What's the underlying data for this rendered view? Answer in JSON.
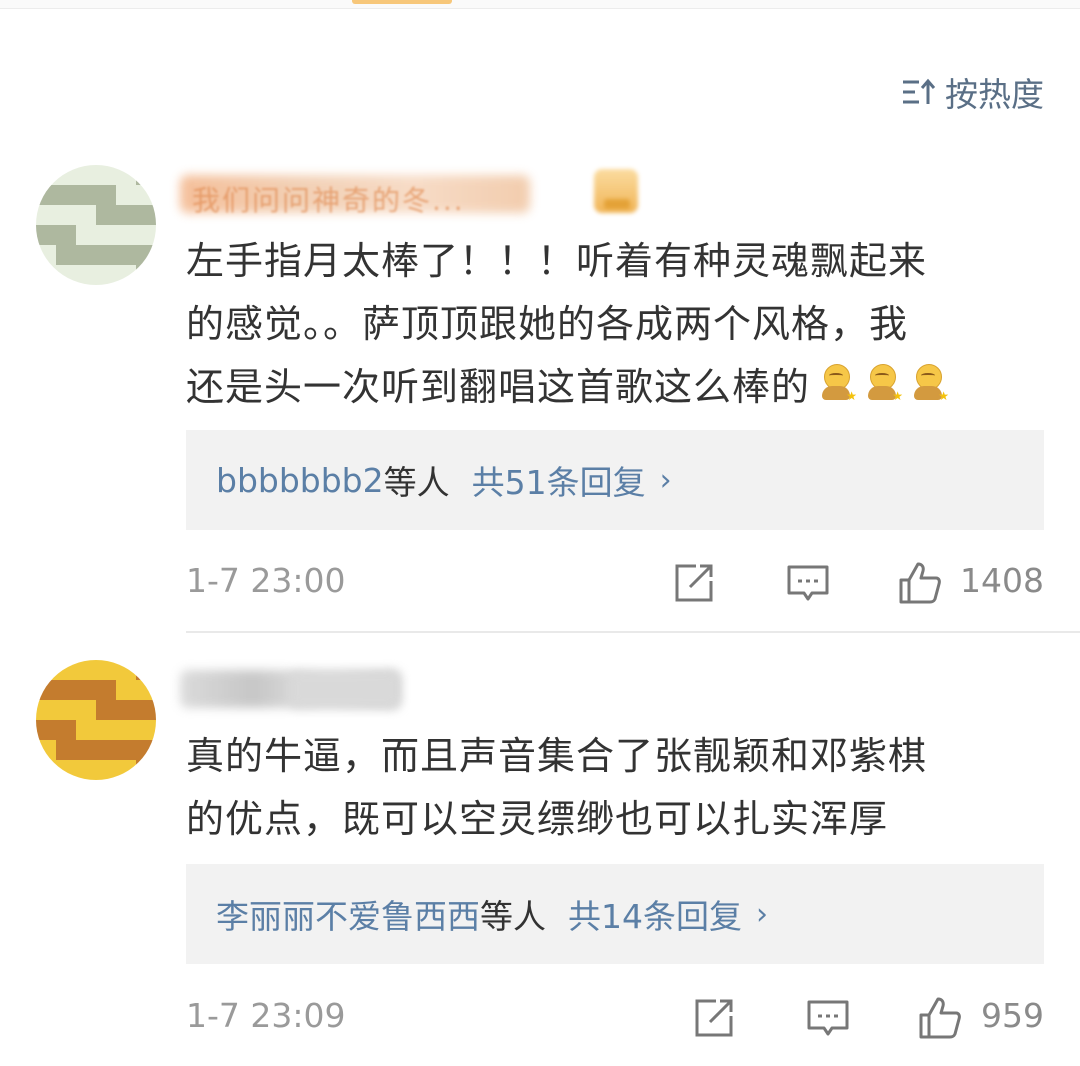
{
  "sort": {
    "label": "按热度",
    "icon": "sort-descending-icon"
  },
  "comments": [
    {
      "username": "我们问问神奇的冬...",
      "text_line1": "左手指月太棒了！！！听着有种灵魂飘起来",
      "text_line2": "的感觉。。萨顶顶跟她的各成两个风格，我",
      "text_line3": "还是头一次听到翻唱这首歌这么棒的",
      "reply": {
        "name": "bbbbbbb2",
        "suffix": "等人",
        "count_text": "共51条回复",
        "chevron": "›"
      },
      "timestamp": "1-7 23:00",
      "likes": "1408"
    },
    {
      "username": "",
      "text_line1": "真的牛逼，而且声音集合了张靓颖和邓紫棋",
      "text_line2": "的优点，既可以空灵缥缈也可以扎实浑厚",
      "reply": {
        "name": "李丽丽不爱鲁西西",
        "suffix": "等人",
        "count_text": "共14条回复",
        "chevron": "›"
      },
      "timestamp": "1-7 23:09",
      "likes": "959"
    }
  ],
  "colors": {
    "link": "#5b7fa6",
    "text": "#333333",
    "meta": "#9a9a9a",
    "reply_bg": "#f2f2f2"
  }
}
